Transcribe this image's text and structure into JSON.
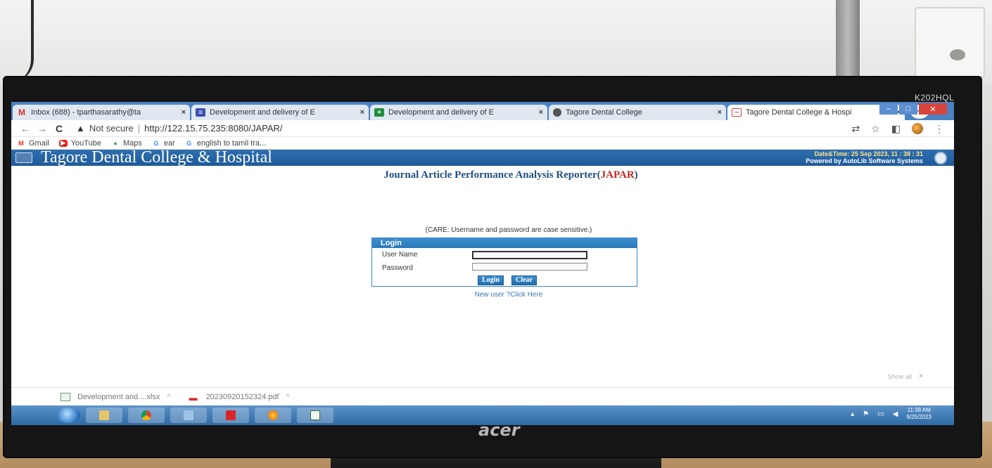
{
  "monitor": {
    "model": "K202HQL",
    "brand": "acer"
  },
  "browser": {
    "tabs": [
      {
        "icon": "gmail-icon",
        "label": "Inbox (688) - tparthasarathy@ta",
        "active": false
      },
      {
        "icon": "forms-icon",
        "label": "Development and delivery of E",
        "active": false
      },
      {
        "icon": "sheets-icon",
        "label": "Development and delivery of E",
        "active": false
      },
      {
        "icon": "globe-icon",
        "label": "Tagore Dental College",
        "active": false
      },
      {
        "icon": "page-icon",
        "label": "Tagore Dental College & Hospi",
        "active": true
      }
    ],
    "new_tab": "+",
    "close_glyph": "×",
    "nav": {
      "back": "←",
      "forward": "→",
      "reload": "C"
    },
    "warning_glyph": "▲",
    "security_label": "Not secure",
    "separator": "|",
    "url": "http://122.15.75.235:8080/JAPAR/",
    "bookmarks": [
      {
        "icon": "gmail-icon",
        "glyph": "M",
        "color": "#d93025",
        "label": "Gmail"
      },
      {
        "icon": "youtube-icon",
        "glyph": "▶",
        "color": "#e62117",
        "label": "YouTube"
      },
      {
        "icon": "maps-icon",
        "glyph": "●",
        "color": "#34a853",
        "label": "Maps"
      },
      {
        "icon": "google-icon",
        "glyph": "G",
        "color": "#4285f4",
        "label": "ear"
      },
      {
        "icon": "google-icon",
        "glyph": "G",
        "color": "#4285f4",
        "label": "english to tamil tra..."
      }
    ]
  },
  "page": {
    "header_title": "Tagore Dental College & Hospital",
    "datetime_label": "Date&Time:  25 Sep 2023, 11 : 38 : 31",
    "powered_by": "Powered by AutoLib Software Systems",
    "app_title_prefix": "Journal Article Performance Analysis Reporter(",
    "app_title_abbr": "JAPAR",
    "app_title_suffix": ")",
    "care_note": "(CARE: Username and password are case sensitive.)",
    "login": {
      "heading": "Login",
      "username_label": "User Name",
      "password_label": "Password",
      "login_button": "Login",
      "clear_button": "Clear"
    },
    "new_user_link": "New user ?Click Here",
    "show_all": "Show all",
    "show_all_close": "×"
  },
  "downloads": [
    {
      "icon": "excel-file-icon",
      "name": "Development and....xlsx"
    },
    {
      "icon": "pdf-file-icon",
      "name": "20230920152324.pdf"
    }
  ],
  "downloads_chevron": "^",
  "taskbar": {
    "clock_time": "11:38 AM",
    "clock_date": "9/25/2023"
  }
}
